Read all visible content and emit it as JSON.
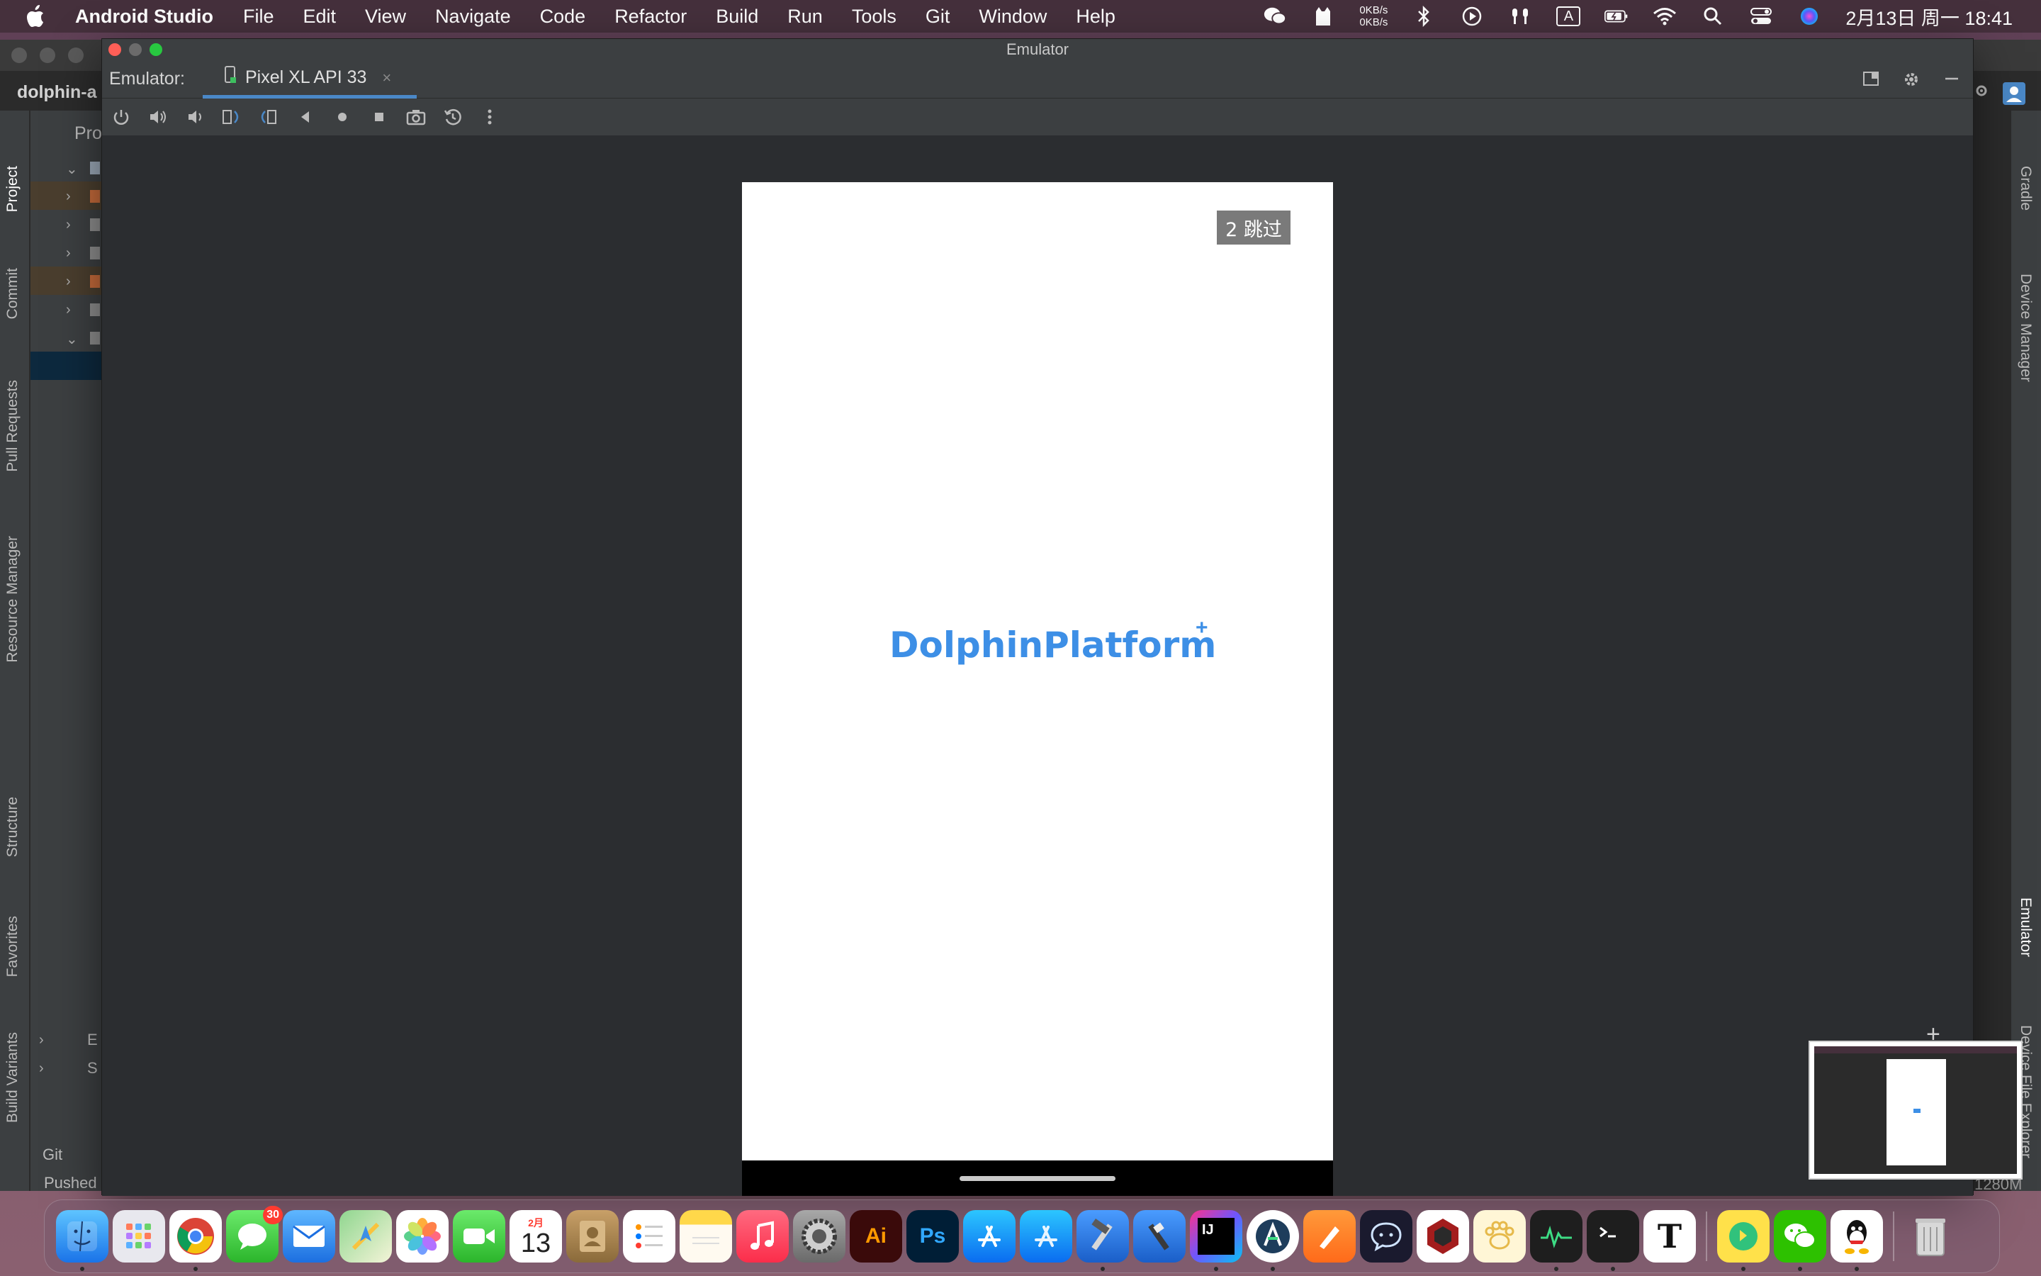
{
  "menubar": {
    "app_name": "Android Studio",
    "menus": [
      "File",
      "Edit",
      "View",
      "Navigate",
      "Code",
      "Refactor",
      "Build",
      "Run",
      "Tools",
      "Git",
      "Window",
      "Help"
    ],
    "net_up": "0KB/s",
    "net_down": "0KB/s",
    "input_method": "A",
    "clock": "2月13日 周一  18:41"
  },
  "ide": {
    "project_name": "dolphin-a",
    "tree_header": "Pro",
    "left_tabs": [
      "Project",
      "Commit",
      "Pull Requests",
      "Resource Manager",
      "Structure",
      "Favorites",
      "Build Variants"
    ],
    "right_tabs": [
      "Gradle",
      "Device Manager",
      "Emulator",
      "Device File Explorer"
    ],
    "tree_tail": [
      "E",
      "S"
    ],
    "status_git": "Git",
    "status_pushed": "Pushed",
    "memory": "1280M"
  },
  "emulator": {
    "window_title": "Emulator",
    "label": "Emulator:",
    "device_tab": "Pixel XL API 33",
    "tab_close": "×",
    "zoom_plus": "+"
  },
  "phone": {
    "skip_label": "2 跳过",
    "logo_text": "DolphinPlatform",
    "logo_plus": "+"
  },
  "dock": {
    "messages_badge": "30",
    "calendar_month": "2月",
    "calendar_day": "13",
    "ai_label": "Ai",
    "ps_label": "Ps",
    "ij_label": "IJ",
    "typora_label": "T"
  },
  "colors": {
    "accent_blue": "#3d8fe6",
    "tab_underline": "#4a88c7",
    "ide_bg": "#2b2d30"
  }
}
